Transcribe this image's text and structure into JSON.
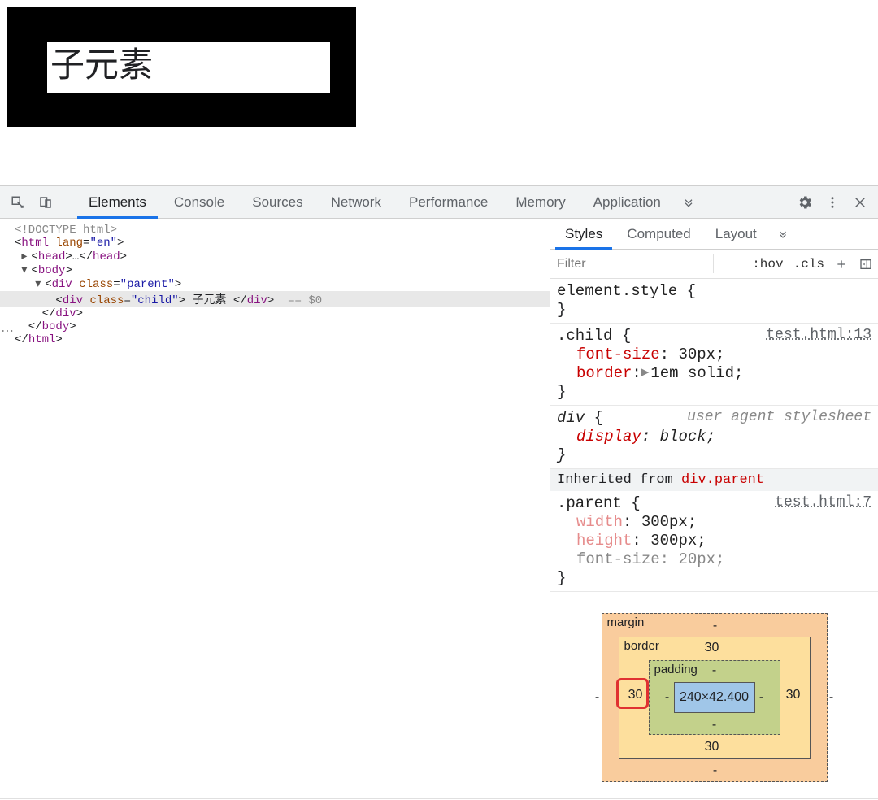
{
  "preview": {
    "child_text": "子元素"
  },
  "devtools_tabs": {
    "items": [
      "Elements",
      "Console",
      "Sources",
      "Network",
      "Performance",
      "Memory",
      "Application"
    ],
    "active": 0
  },
  "dom": {
    "l0": "<!DOCTYPE html>",
    "html_open_tag": "html",
    "html_open_attr": "lang",
    "html_open_val": "\"en\"",
    "head_tag": "head",
    "head_ellipsis": "…",
    "body_tag": "body",
    "parent_tag": "div",
    "parent_attr": "class",
    "parent_val": "\"parent\"",
    "child_tag": "div",
    "child_attr": "class",
    "child_val": "\"child\"",
    "child_text": "子元素",
    "selected_suffix": "== $0"
  },
  "side_tabs": {
    "items": [
      "Styles",
      "Computed",
      "Layout"
    ],
    "active": 0
  },
  "toolbar": {
    "filter_placeholder": "Filter",
    "hov": ":hov",
    "cls": ".cls"
  },
  "styles": {
    "element_style_sel": "element.style",
    "rule_child": {
      "selector": ".child",
      "src": "test.html:13",
      "props": [
        {
          "name": "font-size",
          "value": "30px;"
        },
        {
          "name": "border",
          "value": "1em solid;",
          "expandable": true
        }
      ]
    },
    "rule_div": {
      "selector": "div",
      "uas": "user agent stylesheet",
      "props": [
        {
          "name": "display",
          "value": "block;",
          "italic": true
        }
      ]
    },
    "inherit_label": "Inherited from ",
    "inherit_from": "div.parent",
    "rule_parent": {
      "selector": ".parent",
      "src": "test.html:7",
      "props": [
        {
          "name": "width",
          "value": "300px;",
          "faded": true
        },
        {
          "name": "height",
          "value": "300px;",
          "faded": true
        },
        {
          "name": "font-size",
          "value": "20px;",
          "strike": true
        }
      ]
    }
  },
  "boxmodel": {
    "margin_label": "margin",
    "border_label": "border",
    "padding_label": "padding",
    "margin": {
      "top": "-",
      "right": "-",
      "bottom": "-",
      "left": "-"
    },
    "border": {
      "top": "30",
      "right": "30",
      "bottom": "30",
      "left": "30"
    },
    "padding": {
      "top": "-",
      "right": "-",
      "bottom": "-",
      "left": "-"
    },
    "content": "240×42.400"
  }
}
